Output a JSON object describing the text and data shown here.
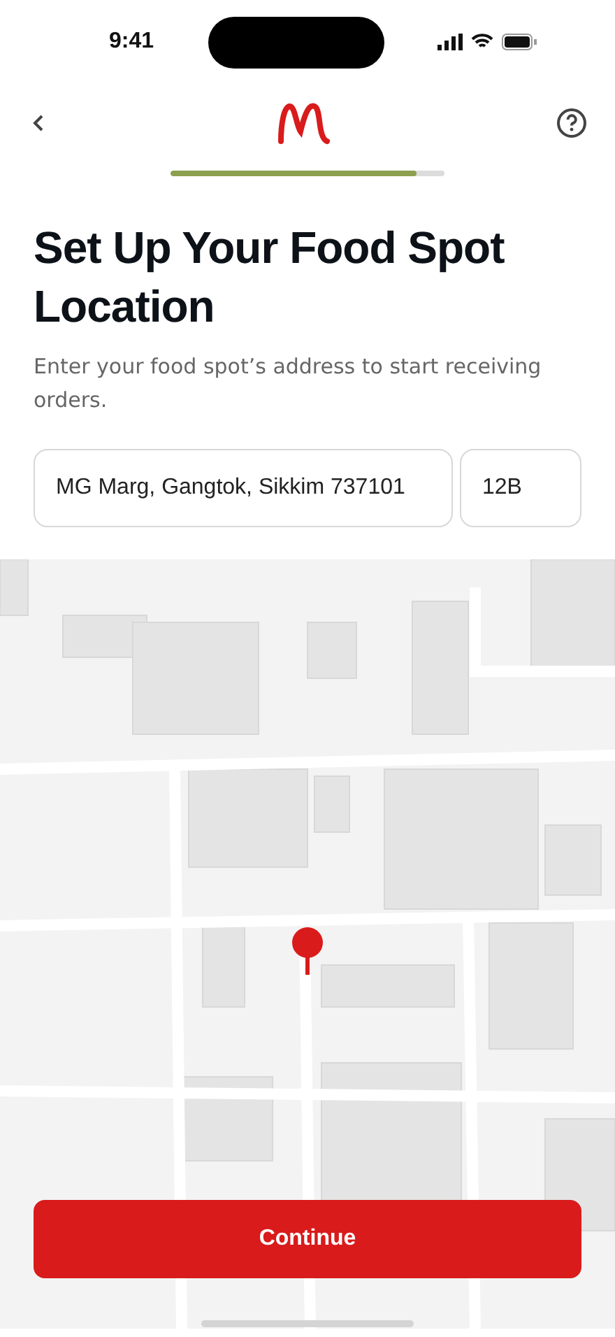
{
  "status_bar": {
    "time": "9:41"
  },
  "progress": {
    "level": 0.9
  },
  "title": "Set Up Your Food Spot Location",
  "subtitle": "Enter your food spot’s address to start receiving orders.",
  "address_fields": [
    {
      "value": "MG Marg, Gangtok, Sikkim 737101"
    },
    {
      "value": "12B"
    }
  ],
  "continue_button": {
    "label": "Continue"
  }
}
